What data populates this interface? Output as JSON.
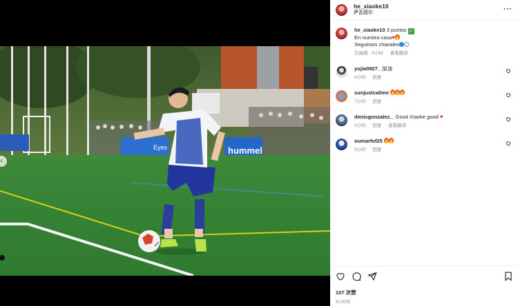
{
  "header": {
    "username": "he_xiaoke10",
    "location": "萨瓦德尔"
  },
  "caption": {
    "username": "he_xiaoke10",
    "text": "3 puntos",
    "line2": "En nuestra casa",
    "line3": "Seguimos chavales",
    "edited": "已编辑 · 9小时",
    "see_translation": "查看翻译"
  },
  "comments": [
    {
      "username": "yujia0927_",
      "text": "加油",
      "time": "4小时",
      "reply": "回复",
      "translate": ""
    },
    {
      "username": "sunjustcallme",
      "text": "",
      "time": "7小时",
      "reply": "回复",
      "translate": ""
    },
    {
      "username": "denisgonzalez._",
      "text": "Good Xiaoke good",
      "time": "9小时",
      "reply": "回复",
      "translate": "查看翻译"
    },
    {
      "username": "oumarfof25",
      "text": "",
      "time": "9小时",
      "reply": "回复",
      "translate": ""
    }
  ],
  "footer": {
    "likes": "107 次赞",
    "time": "9小时前"
  },
  "photo": {
    "banner_text": "hummel",
    "banner_text2": "Eyes"
  },
  "icons": [
    "more-icon",
    "heart-icon",
    "comment-icon",
    "share-icon",
    "bookmark-icon",
    "chevron-left-icon",
    "checkmark-icon",
    "flame-icon"
  ],
  "colors": {
    "accent_green": "#3ea33a",
    "heart_red": "#e0245e",
    "meta_gray": "#8e8e8e"
  }
}
